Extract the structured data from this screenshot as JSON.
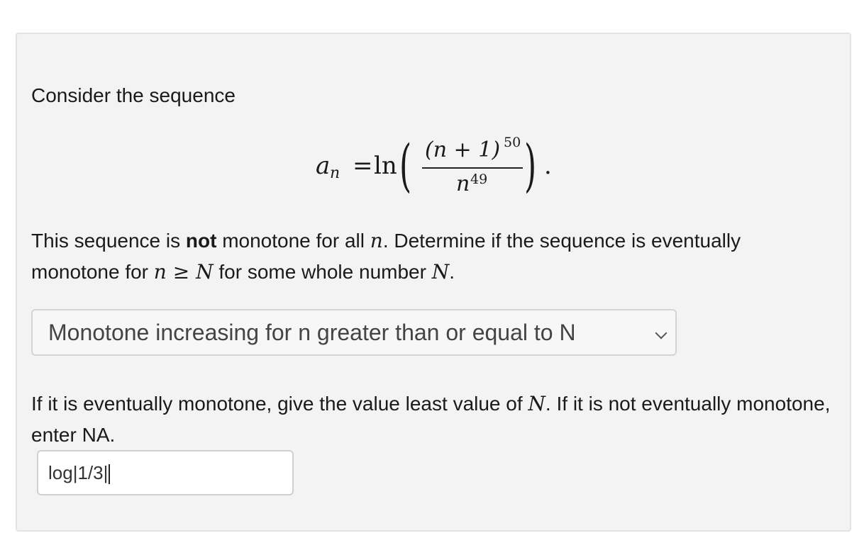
{
  "question": {
    "intro": "Consider the sequence",
    "formula": {
      "lhs_var": "a",
      "lhs_sub": "n",
      "equals": "=",
      "fn": "ln",
      "open_paren": "(",
      "numer": "(n + 1)",
      "numer_exp": "50",
      "denom": "n",
      "denom_exp": "49",
      "close_paren": ")",
      "period": "."
    },
    "p2": {
      "t1": "This sequence is ",
      "bold": "not",
      "t2": " monotone for all ",
      "n": "n",
      "t3": ". Determine if the sequence is eventually monotone for ",
      "ineq": "n ≥ N",
      "t4": " for some whole number ",
      "N": "N",
      "t5": "."
    },
    "dropdown": {
      "selected": "Monotone increasing for n greater than or equal to N"
    },
    "p3": {
      "t1": "If it is eventually monotone, give the value least value of ",
      "N": "N",
      "t2": ". If it is not eventually monotone, enter NA."
    },
    "answer_input": {
      "value": "log|1/3|"
    }
  }
}
